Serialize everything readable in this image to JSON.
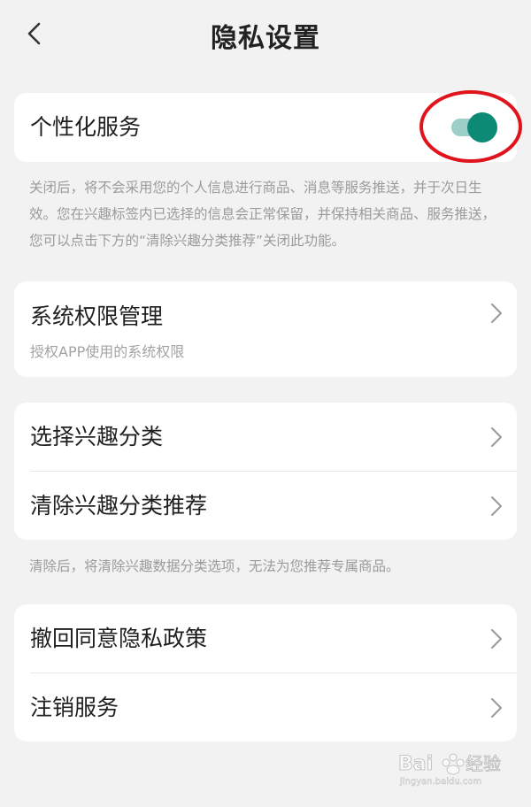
{
  "header": {
    "title": "隐私设置"
  },
  "personalized": {
    "label": "个性化服务",
    "enabled": true,
    "toggle_color": "#0d8a76",
    "highlight_color": "#e0141c",
    "note": "关闭后，将不会采用您的个人信息进行商品、消息等服务推送，并于次日生效。您在兴趣标签内已选择的信息会正常保留，并保持相关商品、服务推送，您可以点击下方的“清除兴趣分类推荐”关闭此功能。"
  },
  "system_permissions": {
    "label": "系统权限管理",
    "subtitle": "授权APP使用的系统权限"
  },
  "interest": {
    "items": [
      {
        "label": "选择兴趣分类"
      },
      {
        "label": "清除兴趣分类推荐"
      }
    ],
    "note": "清除后，将清除兴趣数据分类选项，无法为您推荐专属商品。"
  },
  "account": {
    "items": [
      {
        "label": "撤回同意隐私政策"
      },
      {
        "label": "注销服务"
      }
    ]
  },
  "watermark": {
    "brand": "Baidu经验",
    "url": "jingyan.baidu.com"
  }
}
